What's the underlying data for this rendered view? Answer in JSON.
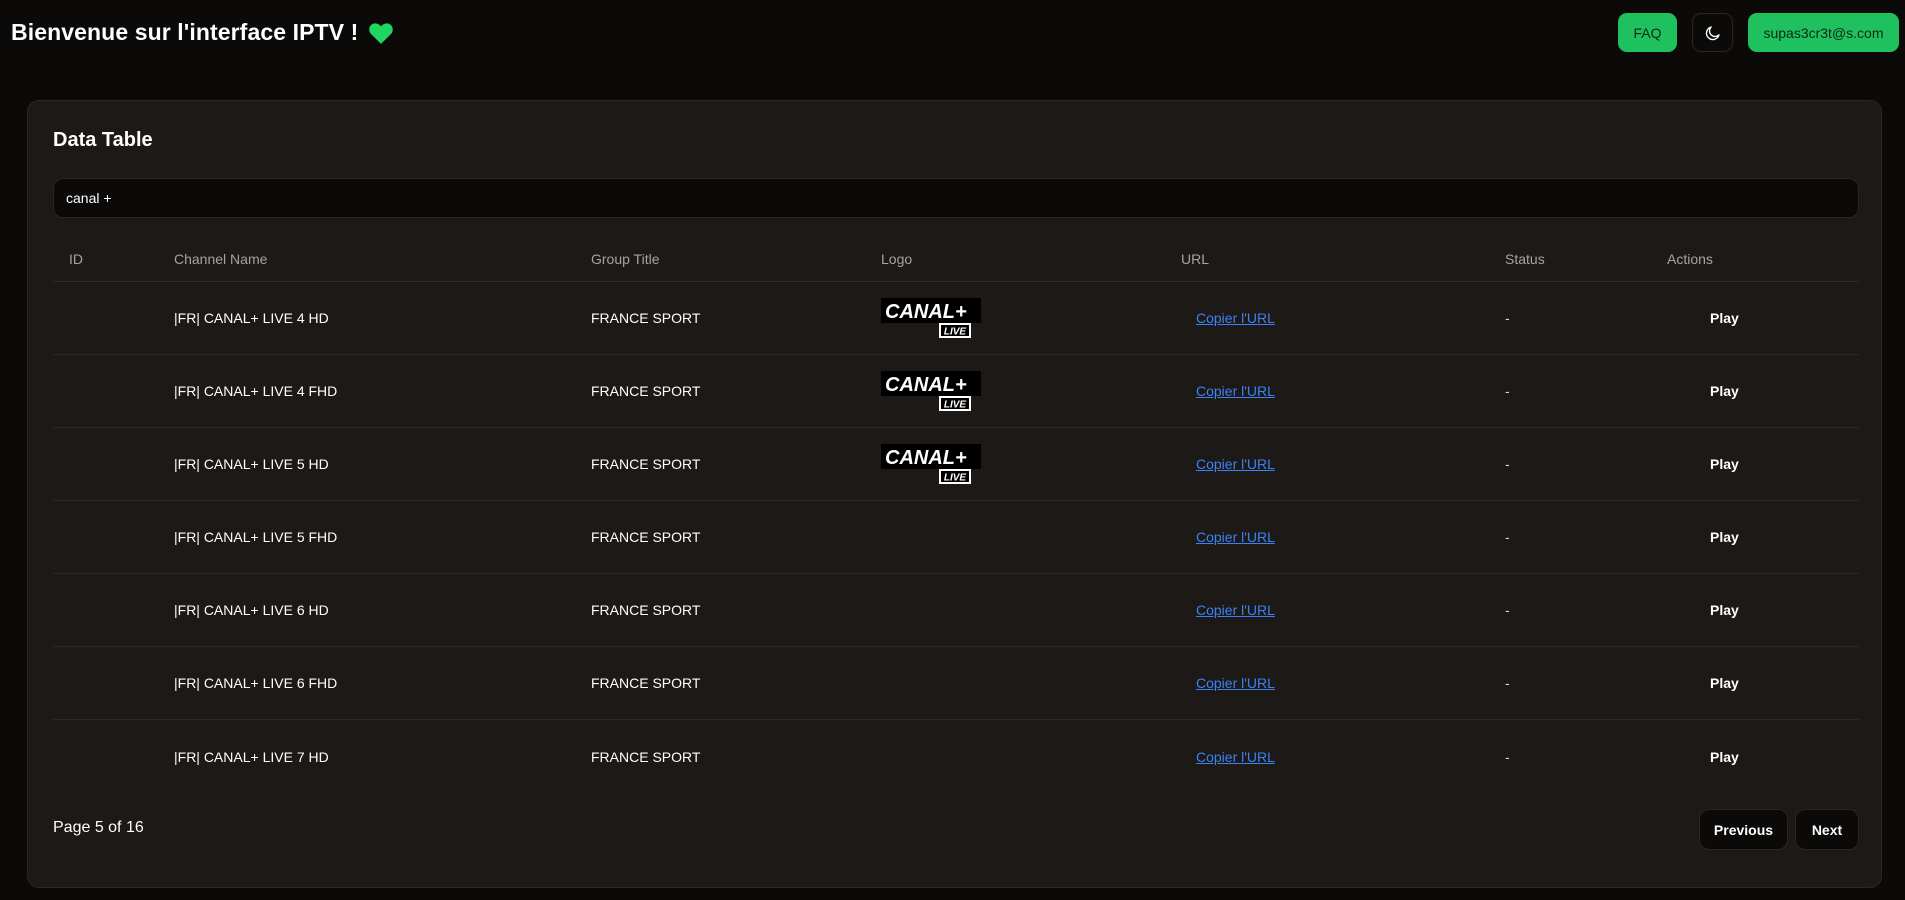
{
  "header": {
    "title": "Bienvenue sur l'interface IPTV !",
    "heart_icon": "green-heart-icon",
    "faq_label": "FAQ",
    "theme_icon": "moon-icon",
    "user_label": "supas3cr3t@s.com"
  },
  "colors": {
    "accent": "#1fc15f",
    "link": "#3b82f6",
    "background": "#0b0a09",
    "card": "#1c1916"
  },
  "card": {
    "title": "Data Table",
    "search": {
      "value": "canal +",
      "placeholder": ""
    }
  },
  "table": {
    "columns": [
      "ID",
      "Channel Name",
      "Group Title",
      "Logo",
      "URL",
      "Status",
      "Actions"
    ],
    "rows": [
      {
        "id": "",
        "name": "|FR| CANAL+ LIVE 4 HD",
        "group": "FRANCE SPORT",
        "logo": true,
        "logo_text": "CANAL+",
        "logo_sub": "LIVE",
        "url_label": "Copier l'URL",
        "status": "-",
        "action": "Play"
      },
      {
        "id": "",
        "name": "|FR| CANAL+ LIVE 4 FHD",
        "group": "FRANCE SPORT",
        "logo": true,
        "logo_text": "CANAL+",
        "logo_sub": "LIVE",
        "url_label": "Copier l'URL",
        "status": "-",
        "action": "Play"
      },
      {
        "id": "",
        "name": "|FR| CANAL+ LIVE 5 HD",
        "group": "FRANCE SPORT",
        "logo": true,
        "logo_text": "CANAL+",
        "logo_sub": "LIVE",
        "url_label": "Copier l'URL",
        "status": "-",
        "action": "Play"
      },
      {
        "id": "",
        "name": "|FR| CANAL+ LIVE 5 FHD",
        "group": "FRANCE SPORT",
        "logo": false,
        "url_label": "Copier l'URL",
        "status": "-",
        "action": "Play"
      },
      {
        "id": "",
        "name": "|FR| CANAL+ LIVE 6 HD",
        "group": "FRANCE SPORT",
        "logo": false,
        "url_label": "Copier l'URL",
        "status": "-",
        "action": "Play"
      },
      {
        "id": "",
        "name": "|FR| CANAL+ LIVE 6 FHD",
        "group": "FRANCE SPORT",
        "logo": false,
        "url_label": "Copier l'URL",
        "status": "-",
        "action": "Play"
      },
      {
        "id": "",
        "name": "|FR| CANAL+ LIVE 7 HD",
        "group": "FRANCE SPORT",
        "logo": false,
        "url_label": "Copier l'URL",
        "status": "-",
        "action": "Play"
      }
    ]
  },
  "pagination": {
    "page_text": "Page 5 of 16",
    "previous_label": "Previous",
    "next_label": "Next"
  }
}
